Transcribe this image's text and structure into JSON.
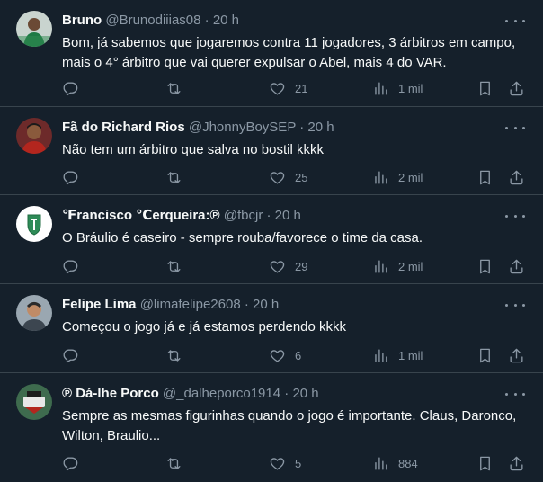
{
  "tweets": [
    {
      "name": "Bruno",
      "handle": "@Brunodiiias08",
      "separator": "·",
      "time": "20 h",
      "text": "Bom, já sabemos que jogaremos contra 11 jogadores, 3 árbitros em campo, mais o 4° árbitro que vai querer expulsar o Abel, mais 4 do VAR.",
      "likes": "21",
      "views": "1 mil"
    },
    {
      "name": "Fã do Richard Rios",
      "handle": "@JhonnyBoySEP",
      "separator": "·",
      "time": "20 h",
      "text": "Não tem um árbitro que salva no bostil kkkk",
      "likes": "25",
      "views": "2 mil"
    },
    {
      "name": "℉rancisco ℃erqueira:℗",
      "handle": "@fbcjr",
      "separator": "·",
      "time": "20 h",
      "text": "O Bráulio é caseiro - sempre rouba/favorece o time da casa.",
      "likes": "29",
      "views": "2 mil"
    },
    {
      "name": "Felipe Lima",
      "handle": "@limafelipe2608",
      "separator": "·",
      "time": "20 h",
      "text": "Começou o jogo já e já estamos perdendo kkkk",
      "likes": "6",
      "views": "1 mil"
    },
    {
      "name": "℗ Dá-lhe Porco",
      "handle": "@_dalheporco1914",
      "separator": "·",
      "time": "20 h",
      "text": "Sempre as mesmas figurinhas quando o jogo é importante. Claus, Daronco, Wilton, Braulio...",
      "likes": "5",
      "views": "884"
    }
  ],
  "icons": {
    "reply": "reply-icon",
    "retweet": "retweet-icon",
    "like": "heart-icon",
    "views": "views-icon",
    "bookmark": "bookmark-icon",
    "share": "share-icon",
    "more": "more-icon"
  },
  "colors": {
    "background": "#15202b",
    "divider": "#38444d",
    "text_primary": "#f7f9f9",
    "text_secondary": "#8b98a5"
  }
}
